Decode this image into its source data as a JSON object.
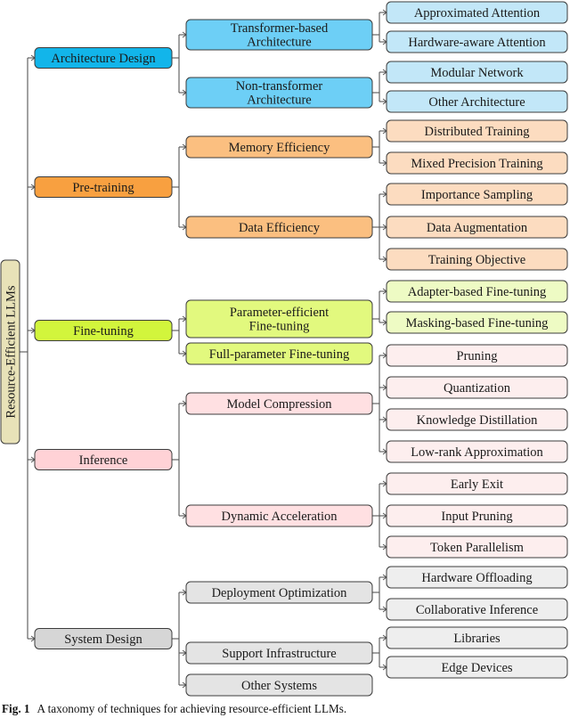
{
  "root": {
    "label": "Resource-Efficient LLMs",
    "color": "#e8e2b8"
  },
  "categories": [
    {
      "label": "Architecture Design",
      "color": "#12b5ea",
      "subcolor": "#6dcff6",
      "leafcolor": "#c2e7f8",
      "children": [
        {
          "label": "Transformer-based Architecture",
          "lines": [
            "Transformer-based",
            "Architecture"
          ],
          "children": [
            "Approximated Attention",
            "Hardware-aware Attention"
          ]
        },
        {
          "label": "Non-transformer Architecture",
          "lines": [
            "Non-transformer",
            "Architecture"
          ],
          "children": [
            "Modular Network",
            "Other Architecture"
          ]
        }
      ]
    },
    {
      "label": "Pre-training",
      "color": "#f8a040",
      "subcolor": "#fbbf80",
      "leafcolor": "#fcdcc0",
      "children": [
        {
          "label": "Memory Efficiency",
          "lines": [
            "Memory Efficiency"
          ],
          "children": [
            "Distributed Training",
            "Mixed Precision Training"
          ]
        },
        {
          "label": "Data Efficiency",
          "lines": [
            "Data Efficiency"
          ],
          "children": [
            "Importance Sampling",
            "Data Augmentation",
            "Training Objective"
          ]
        }
      ]
    },
    {
      "label": "Fine-tuning",
      "color": "#d2f53c",
      "subcolor": "#e2f97e",
      "leafcolor": "#eefbc4",
      "children": [
        {
          "label": "Parameter-efficient Fine-tuning",
          "lines": [
            "Parameter-efficient",
            "Fine-tuning"
          ],
          "children": [
            "Adapter-based Fine-tuning",
            "Masking-based Fine-tuning"
          ]
        },
        {
          "label": "Full-parameter Fine-tuning",
          "lines": [
            "Full-parameter Fine-tuning"
          ],
          "children": []
        }
      ]
    },
    {
      "label": "Inference",
      "color": "#ffd2d6",
      "subcolor": "#ffe0e2",
      "leafcolor": "#fdeeee",
      "children": [
        {
          "label": "Model Compression",
          "lines": [
            "Model Compression"
          ],
          "children": [
            "Pruning",
            "Quantization",
            "Knowledge Distillation",
            "Low-rank Approximation"
          ]
        },
        {
          "label": "Dynamic Acceleration",
          "lines": [
            "Dynamic Acceleration"
          ],
          "children": [
            "Early Exit",
            "Input Pruning",
            "Token Parallelism"
          ]
        }
      ]
    },
    {
      "label": "System Design",
      "color": "#d6d6d6",
      "subcolor": "#e4e4e4",
      "leafcolor": "#eeeeee",
      "children": [
        {
          "label": "Deployment Optimization",
          "lines": [
            "Deployment Optimization"
          ],
          "children": [
            "Hardware Offloading",
            "Collaborative Inference"
          ]
        },
        {
          "label": "Support Infrastructure",
          "lines": [
            "Support Infrastructure"
          ],
          "children": [
            "Libraries",
            "Edge Devices"
          ]
        },
        {
          "label": "Other Systems",
          "lines": [
            "Other Systems"
          ],
          "children": []
        }
      ]
    }
  ],
  "caption": {
    "fig_label": "Fig. 1",
    "text": "A taxonomy of techniques for achieving resource-efficient LLMs."
  },
  "style": {
    "stroke": "#3c3c3c",
    "line": "#555555"
  }
}
